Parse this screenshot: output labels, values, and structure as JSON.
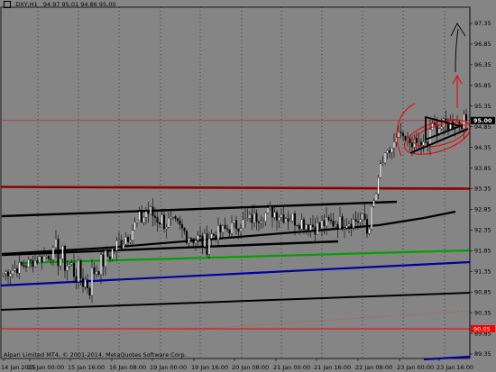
{
  "header": {
    "symbol": "_DXY,H1",
    "ohlc": "94.97 95.01 94.86 95.00"
  },
  "footer": {
    "copyright": "Alpari Limited MT4, © 2001-2014, MetaQuotes Software Corp."
  },
  "price_axis": {
    "ticks": [
      "97.35",
      "96.85",
      "96.35",
      "95.85",
      "95.35",
      "94.85",
      "94.35",
      "93.85",
      "93.35",
      "92.85",
      "92.35",
      "91.85",
      "91.35",
      "90.85",
      "90.35",
      "89.85",
      "89.35"
    ],
    "current_price": "95.00",
    "marker_price": "90.05"
  },
  "time_axis": {
    "ticks": [
      "14 Jan 2015",
      "15 Jan 00:00",
      "15 Jan 16:00",
      "16 Jan 08:00",
      "19 Jan 00:00",
      "19 Jan 16:00",
      "20 Jan 08:00",
      "21 Jan 00:00",
      "21 Jan 16:00",
      "22 Jan 08:00",
      "23 Jan 00:00",
      "23 Jan 16:00"
    ]
  },
  "colors": {
    "background": "#858585",
    "bull": "#ffffff",
    "bear": "#000000",
    "resistance": "#8b0000",
    "green_line": "#00a000",
    "blue_line": "#0000a0",
    "red_marker": "#ff0000"
  },
  "chart_data": {
    "type": "candlestick",
    "ylim": [
      89.35,
      97.35
    ],
    "horizontal_levels": [
      {
        "value": 93.35,
        "color": "resistance"
      },
      {
        "value": 95.0,
        "color": "current"
      }
    ]
  }
}
